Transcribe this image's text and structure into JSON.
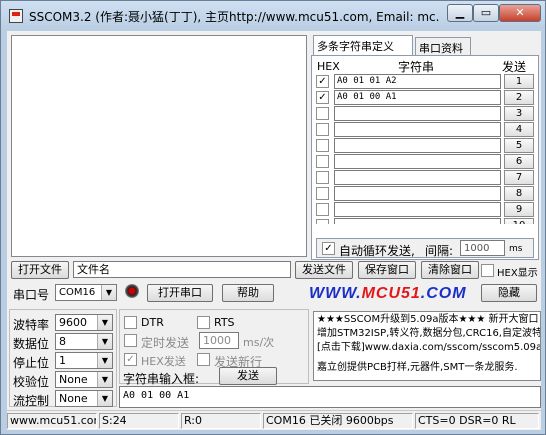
{
  "window": {
    "title": "SSCOM3.2 (作者:聂小猛(丁丁), 主页http://www.mcu51.com,  Email: mc...",
    "min_label": "▁",
    "max_label": "▭",
    "close_label": "✕"
  },
  "tabs": [
    "多条字符串定义",
    "串口资料"
  ],
  "multistr": {
    "header_hex": "HEX",
    "header_str": "字符串",
    "header_send": "发送",
    "rows": [
      {
        "checked": true,
        "value": "A0 01 01 A2",
        "send": "1"
      },
      {
        "checked": true,
        "value": "A0 01 00 A1",
        "send": "2"
      },
      {
        "checked": false,
        "value": "",
        "send": "3"
      },
      {
        "checked": false,
        "value": "",
        "send": "4"
      },
      {
        "checked": false,
        "value": "",
        "send": "5"
      },
      {
        "checked": false,
        "value": "",
        "send": "6"
      },
      {
        "checked": false,
        "value": "",
        "send": "7"
      },
      {
        "checked": false,
        "value": "",
        "send": "8"
      },
      {
        "checked": false,
        "value": "",
        "send": "9"
      },
      {
        "checked": false,
        "value": "",
        "send": "10"
      }
    ],
    "loop_label": "自动循环发送,",
    "interval_label": "间隔:",
    "interval_value": "1000",
    "interval_unit": "ms"
  },
  "file": {
    "open_label": "打开文件",
    "name_label": "文件名",
    "send_file_label": "发送文件",
    "save_window_label": "保存窗口",
    "clear_window_label": "清除窗口",
    "hex_display_label": "HEX显示"
  },
  "port": {
    "port_label": "串口号",
    "port_value": "COM16",
    "open_port_label": "打开串口",
    "help_label": "帮助",
    "hide_label": "隐藏"
  },
  "logo": {
    "pre": "WWW.",
    "mid": "MCU51",
    "post": ".COM"
  },
  "settings": {
    "baud_label": "波特率",
    "baud_value": "9600",
    "data_label": "数据位",
    "data_value": "8",
    "stop_label": "停止位",
    "stop_value": "1",
    "parity_label": "校验位",
    "parity_value": "None",
    "flow_label": "流控制",
    "flow_value": "None"
  },
  "controls": {
    "dtr_label": "DTR",
    "rts_label": "RTS",
    "timed_send_label": "定时发送",
    "timed_value": "1000",
    "timed_unit": "ms/次",
    "hex_send_label": "HEX发送",
    "send_newline_label": "发送新行",
    "input_label": "字符串输入框:",
    "send_label": "发送",
    "input_value": "A0 01 00 A1"
  },
  "info_lines": [
    "★★★SSCOM升级到5.09a版本★★★ 新开大窗口",
    "增加STM32ISP,转义符,数据分包,CRC16,自定波特",
    "[点击下载]www.daxia.com/sscom/sscom5.09a.ra",
    "",
    "嘉立创提供PCB打样,元器件,SMT一条龙服务."
  ],
  "status": {
    "site": "www.mcu51.cor",
    "sent": "S:24",
    "recv": "R:0",
    "port_state": "COM16 已关闭  9600bps",
    "lines": "CTS=0 DSR=0 RL"
  }
}
